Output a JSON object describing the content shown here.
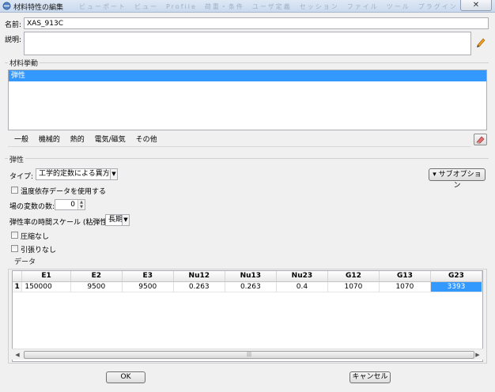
{
  "window": {
    "title": "材料特性の編集",
    "close_glyph": "✕",
    "background_menu": "ビューポート　ビュー　Profile　荷重・条件　ユーザ定義　セッション　ファイル　ツール　プラグイン　ヘルプ"
  },
  "name": {
    "label": "名前:",
    "value": "XAS_913C"
  },
  "description": {
    "label": "説明:",
    "value": ""
  },
  "material_behaviors": {
    "title": "材料挙動",
    "items": [
      "弾性"
    ]
  },
  "tabs": [
    "一般",
    "機械的",
    "熱的",
    "電気/磁気",
    "その他"
  ],
  "elastic": {
    "title": "弾性",
    "type_label": "タイプ:",
    "type_value": "工学的定数による異方性",
    "suboption_label": "▾ サブオプション",
    "temp_dependent_label": "温度依存データを使用する",
    "field_vars_label": "場の変数の数:",
    "field_vars_value": "0",
    "timescale_label": "弾性率の時間スケール (粘弾性):",
    "timescale_value": "長期",
    "no_compression_label": "圧縮なし",
    "no_tension_label": "引張りなし"
  },
  "data": {
    "title": "データ",
    "columns": [
      "E1",
      "E2",
      "E3",
      "Nu12",
      "Nu13",
      "Nu23",
      "G12",
      "G13",
      "G23"
    ],
    "row_number": "1",
    "row": [
      "150000",
      "9500",
      "9500",
      "0.263",
      "0.263",
      "0.4",
      "1070",
      "1070",
      "3393"
    ]
  },
  "buttons": {
    "ok": "OK",
    "cancel": "キャンセル"
  },
  "colors": {
    "selection": "#3399ff",
    "dialog_bg": "#f0f0f0"
  }
}
